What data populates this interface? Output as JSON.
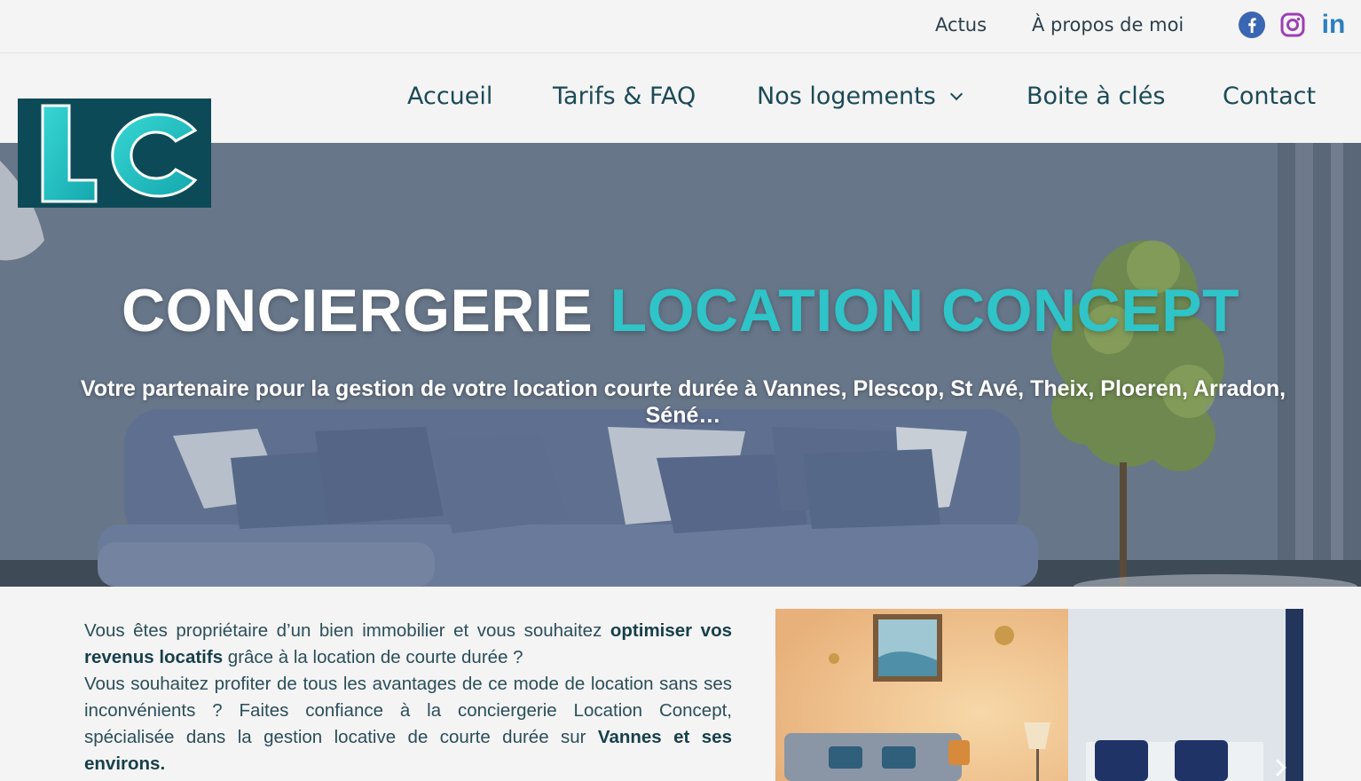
{
  "topbar": {
    "links": [
      "Actus",
      "À propos de moi"
    ],
    "social": [
      "facebook-icon",
      "instagram-icon",
      "linkedin-icon"
    ],
    "linkedin_text": "in"
  },
  "nav": {
    "items": [
      "Accueil",
      "Tarifs & FAQ",
      "Nos logements",
      "Boite à clés",
      "Contact"
    ]
  },
  "logo": {
    "text": "LC",
    "colors": {
      "bg": "#0d4a57",
      "accent": "#2fc4c7"
    }
  },
  "hero": {
    "title_white": "CONCIERGERIE",
    "title_accent": "LOCATION CONCEPT",
    "subtitle": "Votre partenaire pour la gestion de votre location courte durée à Vannes, Plescop, St Avé, Theix, Ploeren, Arradon, Séné…"
  },
  "intro": {
    "p1_a": "Vous êtes propriétaire d’un bien immobilier et vous souhaitez ",
    "p1_b": "optimiser vos revenus locatifs",
    "p1_c": " grâce à la location de courte durée ?",
    "p2_a": "Vous souhaitez profiter de tous les avantages de ce mode de location sans ses inconvénients ? Faites confiance à la conciergerie Location Concept, spécialisée dans la gestion locative de courte durée sur ",
    "p2_b": "Vannes et ses environs."
  },
  "colors": {
    "accent": "#2fc4c7",
    "nav_text": "#1b4a56",
    "background": "#f4f4f4"
  }
}
